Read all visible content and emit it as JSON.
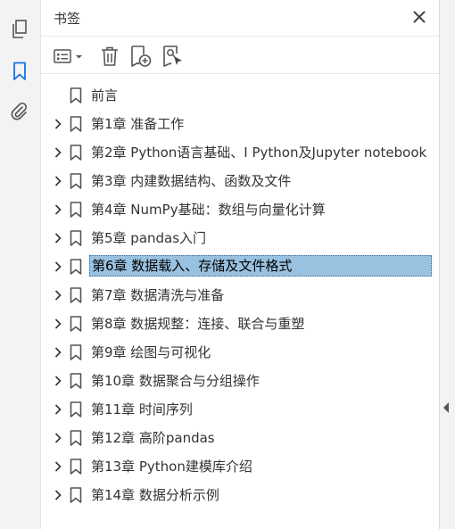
{
  "panel": {
    "title": "书签"
  },
  "colors": {
    "selection": "#99c1e0",
    "selection_border": "#3a6c9a",
    "accent_icon": "#1473e6",
    "icon_gray": "#555555"
  },
  "rail": {
    "items": [
      {
        "name": "pages",
        "icon": "pages-icon",
        "active": false
      },
      {
        "name": "bookmarks",
        "icon": "bookmark-icon",
        "active": true
      },
      {
        "name": "attachments",
        "icon": "paperclip-icon",
        "active": false
      }
    ]
  },
  "toolbar": {
    "items": [
      {
        "name": "options-menu",
        "icon": "list-options-icon"
      },
      {
        "name": "delete",
        "icon": "trash-icon"
      },
      {
        "name": "new-bookmark",
        "icon": "new-bookmark-icon"
      },
      {
        "name": "find-bookmark",
        "icon": "find-bookmark-icon"
      }
    ]
  },
  "bookmarks": [
    {
      "label": "前言",
      "expandable": false,
      "selected": false
    },
    {
      "label": "第1章 准备工作",
      "expandable": true,
      "selected": false
    },
    {
      "label": "第2章 Python语言基础、I Python及Jupyter notebook",
      "expandable": true,
      "selected": false
    },
    {
      "label": "第3章 内建数据结构、函数及文件",
      "expandable": true,
      "selected": false
    },
    {
      "label": "第4章 NumPy基础：数组与向量化计算",
      "expandable": true,
      "selected": false
    },
    {
      "label": "第5章 pandas入门",
      "expandable": true,
      "selected": false
    },
    {
      "label": "第6章 数据载入、存储及文件格式",
      "expandable": true,
      "selected": true
    },
    {
      "label": "第7章 数据清洗与准备",
      "expandable": true,
      "selected": false
    },
    {
      "label": "第8章 数据规整：连接、联合与重塑",
      "expandable": true,
      "selected": false
    },
    {
      "label": "第9章 绘图与可视化",
      "expandable": true,
      "selected": false
    },
    {
      "label": "第10章 数据聚合与分组操作",
      "expandable": true,
      "selected": false
    },
    {
      "label": "第11章 时间序列",
      "expandable": true,
      "selected": false
    },
    {
      "label": "第12章 高阶pandas",
      "expandable": true,
      "selected": false
    },
    {
      "label": "第13章 Python建模库介绍",
      "expandable": true,
      "selected": false
    },
    {
      "label": "第14章 数据分析示例",
      "expandable": true,
      "selected": false
    }
  ]
}
